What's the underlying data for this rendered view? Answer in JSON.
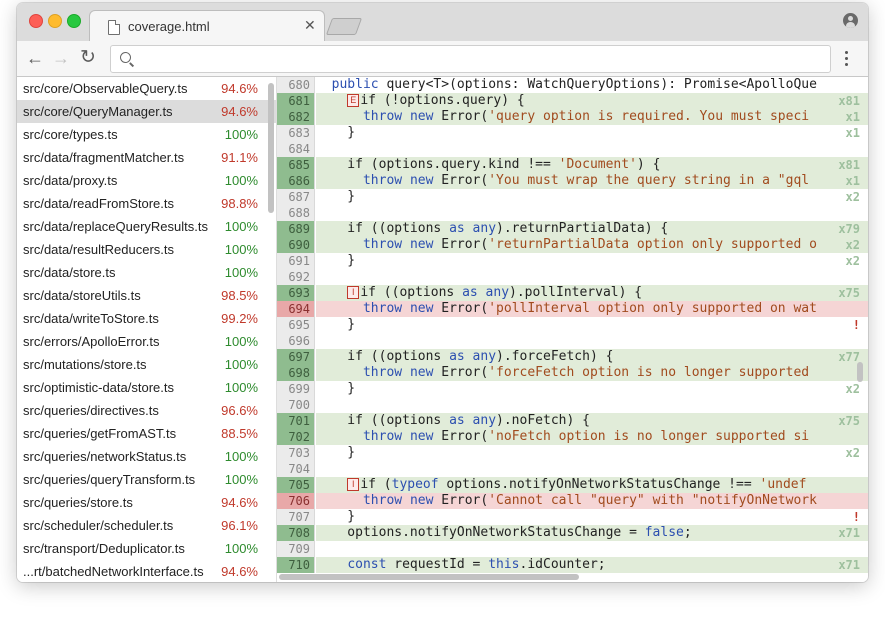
{
  "tab": {
    "title": "coverage.html",
    "close": "✕"
  },
  "toolbar": {
    "back": "←",
    "forward": "→",
    "reload": "↻"
  },
  "files": [
    {
      "name": "src/core/ObservableQuery.ts",
      "pct": "94.6%",
      "status": "red"
    },
    {
      "name": "src/core/QueryManager.ts",
      "pct": "94.6%",
      "status": "red",
      "selected": true
    },
    {
      "name": "src/core/types.ts",
      "pct": "100%",
      "status": "green"
    },
    {
      "name": "src/data/fragmentMatcher.ts",
      "pct": "91.1%",
      "status": "red"
    },
    {
      "name": "src/data/proxy.ts",
      "pct": "100%",
      "status": "green"
    },
    {
      "name": "src/data/readFromStore.ts",
      "pct": "98.8%",
      "status": "red"
    },
    {
      "name": "src/data/replaceQueryResults.ts",
      "pct": "100%",
      "status": "green"
    },
    {
      "name": "src/data/resultReducers.ts",
      "pct": "100%",
      "status": "green"
    },
    {
      "name": "src/data/store.ts",
      "pct": "100%",
      "status": "green"
    },
    {
      "name": "src/data/storeUtils.ts",
      "pct": "98.5%",
      "status": "red"
    },
    {
      "name": "src/data/writeToStore.ts",
      "pct": "99.2%",
      "status": "red"
    },
    {
      "name": "src/errors/ApolloError.ts",
      "pct": "100%",
      "status": "green"
    },
    {
      "name": "src/mutations/store.ts",
      "pct": "100%",
      "status": "green"
    },
    {
      "name": "src/optimistic-data/store.ts",
      "pct": "100%",
      "status": "green"
    },
    {
      "name": "src/queries/directives.ts",
      "pct": "96.6%",
      "status": "red"
    },
    {
      "name": "src/queries/getFromAST.ts",
      "pct": "88.5%",
      "status": "red"
    },
    {
      "name": "src/queries/networkStatus.ts",
      "pct": "100%",
      "status": "green"
    },
    {
      "name": "src/queries/queryTransform.ts",
      "pct": "100%",
      "status": "green"
    },
    {
      "name": "src/queries/store.ts",
      "pct": "94.6%",
      "status": "red"
    },
    {
      "name": "src/scheduler/scheduler.ts",
      "pct": "96.1%",
      "status": "red"
    },
    {
      "name": "src/transport/Deduplicator.ts",
      "pct": "100%",
      "status": "green"
    },
    {
      "name": "...rt/batchedNetworkInterface.ts",
      "pct": "94.6%",
      "status": "red"
    }
  ],
  "code_lines": [
    {
      "n": "680",
      "cov": "none",
      "badge": "",
      "hit": "",
      "html": "  <span class=\"kw\">public</span> query&lt;T&gt;(options: WatchQueryOptions): Promise&lt;ApolloQue"
    },
    {
      "n": "681",
      "cov": "cov",
      "badge": "E",
      "hit": "x81",
      "html": "    if (!options.query) {"
    },
    {
      "n": "682",
      "cov": "cov",
      "badge": "",
      "hit": "x1",
      "html": "      <span class=\"kw\">throw</span> <span class=\"kw\">new</span> Error(<span class=\"str\">'query option is required. You must speci</span>"
    },
    {
      "n": "683",
      "cov": "none",
      "badge": "",
      "hit": "x1",
      "html": "    }"
    },
    {
      "n": "684",
      "cov": "none",
      "badge": "",
      "hit": "",
      "html": ""
    },
    {
      "n": "685",
      "cov": "cov",
      "badge": "",
      "hit": "x81",
      "html": "    if (options.query.kind !== <span class=\"str\">'Document'</span>) {"
    },
    {
      "n": "686",
      "cov": "cov",
      "badge": "",
      "hit": "x1",
      "html": "      <span class=\"kw\">throw</span> <span class=\"kw\">new</span> Error(<span class=\"str\">'You must wrap the query string in a \"gql</span>"
    },
    {
      "n": "687",
      "cov": "none",
      "badge": "",
      "hit": "x2",
      "html": "    }"
    },
    {
      "n": "688",
      "cov": "none",
      "badge": "",
      "hit": "",
      "html": ""
    },
    {
      "n": "689",
      "cov": "cov",
      "badge": "",
      "hit": "x79",
      "html": "    if ((options <span class=\"kw\">as</span> <span class=\"kw\">any</span>).returnPartialData) {"
    },
    {
      "n": "690",
      "cov": "cov",
      "badge": "",
      "hit": "x2",
      "html": "      <span class=\"kw\">throw</span> <span class=\"kw\">new</span> Error(<span class=\"str\">'returnPartialData option only supported o</span>"
    },
    {
      "n": "691",
      "cov": "none",
      "badge": "",
      "hit": "x2",
      "html": "    }"
    },
    {
      "n": "692",
      "cov": "none",
      "badge": "",
      "hit": "",
      "html": ""
    },
    {
      "n": "693",
      "cov": "cov",
      "badge": "I",
      "hit": "x75",
      "html": "    if ((options <span class=\"kw\">as</span> <span class=\"kw\">any</span>).pollInterval) {"
    },
    {
      "n": "694",
      "cov": "uncov",
      "badge": "",
      "hit": "",
      "html": "      <span class=\"kw\">throw</span> <span class=\"kw\">new</span> Error(<span class=\"str\">'pollInterval option only supported on wat</span>"
    },
    {
      "n": "695",
      "cov": "none",
      "badge": "",
      "hit": "!",
      "html": "    }"
    },
    {
      "n": "696",
      "cov": "none",
      "badge": "",
      "hit": "",
      "html": ""
    },
    {
      "n": "697",
      "cov": "cov",
      "badge": "",
      "hit": "x77",
      "html": "    if ((options <span class=\"kw\">as</span> <span class=\"kw\">any</span>).forceFetch) {"
    },
    {
      "n": "698",
      "cov": "cov",
      "badge": "",
      "hit": "",
      "html": "      <span class=\"kw\">throw</span> <span class=\"kw\">new</span> Error(<span class=\"str\">'forceFetch option is no longer supported</span>"
    },
    {
      "n": "699",
      "cov": "none",
      "badge": "",
      "hit": "x2",
      "html": "    }"
    },
    {
      "n": "700",
      "cov": "none",
      "badge": "",
      "hit": "",
      "html": ""
    },
    {
      "n": "701",
      "cov": "cov",
      "badge": "",
      "hit": "x75",
      "html": "    if ((options <span class=\"kw\">as</span> <span class=\"kw\">any</span>).noFetch) {"
    },
    {
      "n": "702",
      "cov": "cov",
      "badge": "",
      "hit": "",
      "html": "      <span class=\"kw\">throw</span> <span class=\"kw\">new</span> Error(<span class=\"str\">'noFetch option is no longer supported si</span>"
    },
    {
      "n": "703",
      "cov": "none",
      "badge": "",
      "hit": "x2",
      "html": "    }"
    },
    {
      "n": "704",
      "cov": "none",
      "badge": "",
      "hit": "",
      "html": ""
    },
    {
      "n": "705",
      "cov": "cov",
      "badge": "I",
      "hit": "",
      "html": "    if (<span class=\"kw\">typeof</span> options.notifyOnNetworkStatusChange !== <span class=\"str\">'undef</span>"
    },
    {
      "n": "706",
      "cov": "uncov",
      "badge": "",
      "hit": "",
      "html": "      <span class=\"kw\">throw</span> <span class=\"kw\">new</span> Error(<span class=\"str\">'Cannot call \"query\" with \"notifyOnNetwork</span>"
    },
    {
      "n": "707",
      "cov": "none",
      "badge": "",
      "hit": "!",
      "html": "    }"
    },
    {
      "n": "708",
      "cov": "cov",
      "badge": "",
      "hit": "x71",
      "html": "    options.notifyOnNetworkStatusChange = <span class=\"kw\">false</span>;"
    },
    {
      "n": "709",
      "cov": "none",
      "badge": "",
      "hit": "",
      "html": ""
    },
    {
      "n": "710",
      "cov": "cov",
      "badge": "",
      "hit": "x71",
      "html": "    <span class=\"kw\">const</span> requestId = <span class=\"kw\">this</span>.idCounter;"
    }
  ],
  "colors": {
    "covered": "#e1ecd9",
    "uncovered": "#f5d5d5",
    "covered_gutter": "#8fbc8f",
    "uncovered_gutter": "#e8a8a8"
  }
}
